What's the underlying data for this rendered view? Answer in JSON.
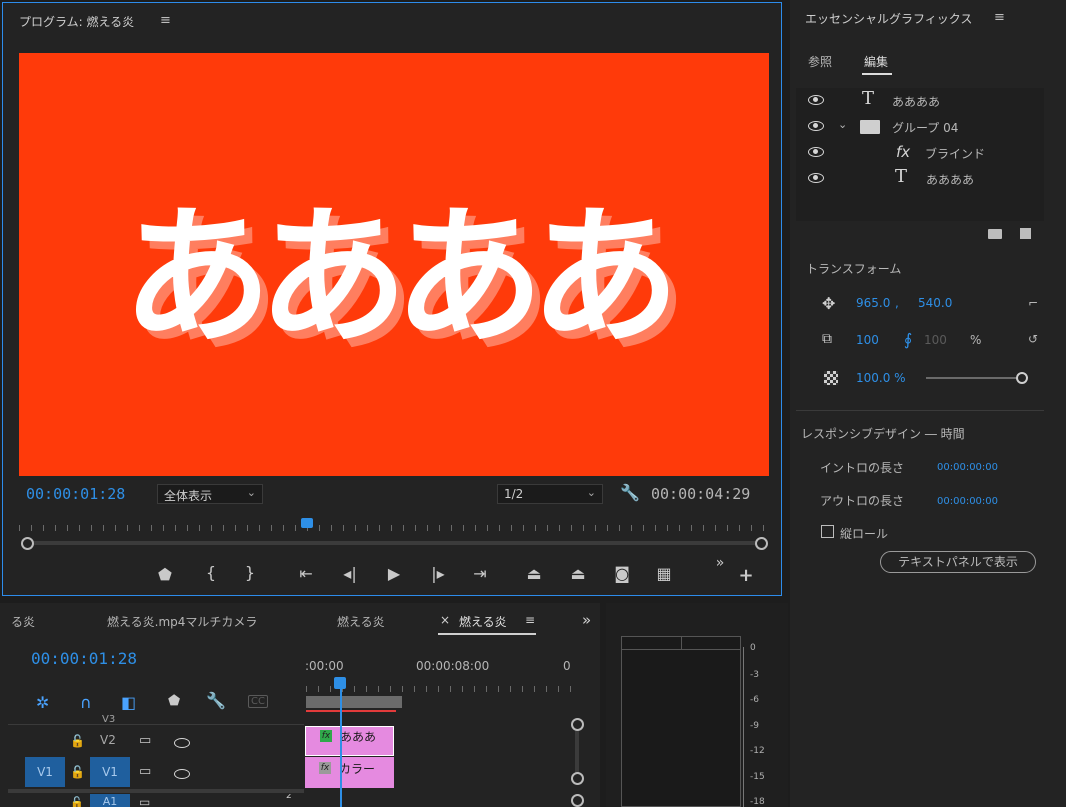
{
  "program": {
    "title": "プログラム: 燃える炎",
    "menu": "≡",
    "video_text": "ああああ",
    "current_time": "00:00:01:28",
    "fit_label": "全体表示",
    "resolution": "1/2",
    "duration": "00:00:04:29",
    "controls": [
      "marker-icon",
      "in-point-icon",
      "out-point-icon",
      "go-to-in-icon",
      "step-back-icon",
      "play-icon",
      "step-forward-icon",
      "go-to-out-icon",
      "lift-icon",
      "extract-icon",
      "export-frame-icon",
      "comparison-view-icon",
      "more-icon",
      "add-button-icon"
    ]
  },
  "eg": {
    "title": "エッセンシャルグラフィックス",
    "menu": "≡",
    "tab_browse": "参照",
    "tab_edit": "編集",
    "layers": [
      {
        "label": "ああああ",
        "type": "text"
      },
      {
        "label": "グループ 04",
        "type": "group"
      },
      {
        "label": "ブラインド",
        "type": "fx"
      },
      {
        "label": "ああああ",
        "type": "text"
      }
    ],
    "transform_title": "トランスフォーム",
    "pos_x": "965.0",
    "pos_sep": ",",
    "pos_y": "540.0",
    "scale": "100",
    "scale2": "100",
    "percent": "%",
    "opacity": "100.0 %",
    "opacity_level": 1.0,
    "responsive_title": "レスポンシブデザイン ― 時間",
    "intro_label": "イントロの長さ",
    "intro_value": "00:00:00:00",
    "outro_label": "アウトロの長さ",
    "outro_value": "00:00:00:00",
    "roll_label": "縦ロール",
    "text_panel_button": "テキストパネルで表示"
  },
  "timeline": {
    "tabs": [
      "る炎",
      "燃える炎.mp4マルチカメラ",
      "燃える炎",
      "燃える炎"
    ],
    "close_symbol": "×",
    "menu": "≡",
    "more": "»",
    "current_time": "00:00:01:28",
    "ruler": [
      ":00:00",
      "00:00:08:00",
      "0"
    ],
    "tracks": {
      "v3": "V3",
      "v2": "V2",
      "v1_source": "V1",
      "v1": "V1",
      "a1": "A1",
      "a_num": "2"
    },
    "clips": [
      {
        "label": "あああ",
        "fx": "fx"
      },
      {
        "label": "カラー",
        "fx": "fx"
      }
    ]
  },
  "meter": {
    "db": [
      "0",
      "-3",
      "-6",
      "-9",
      "-12",
      "-15",
      "-18"
    ]
  }
}
